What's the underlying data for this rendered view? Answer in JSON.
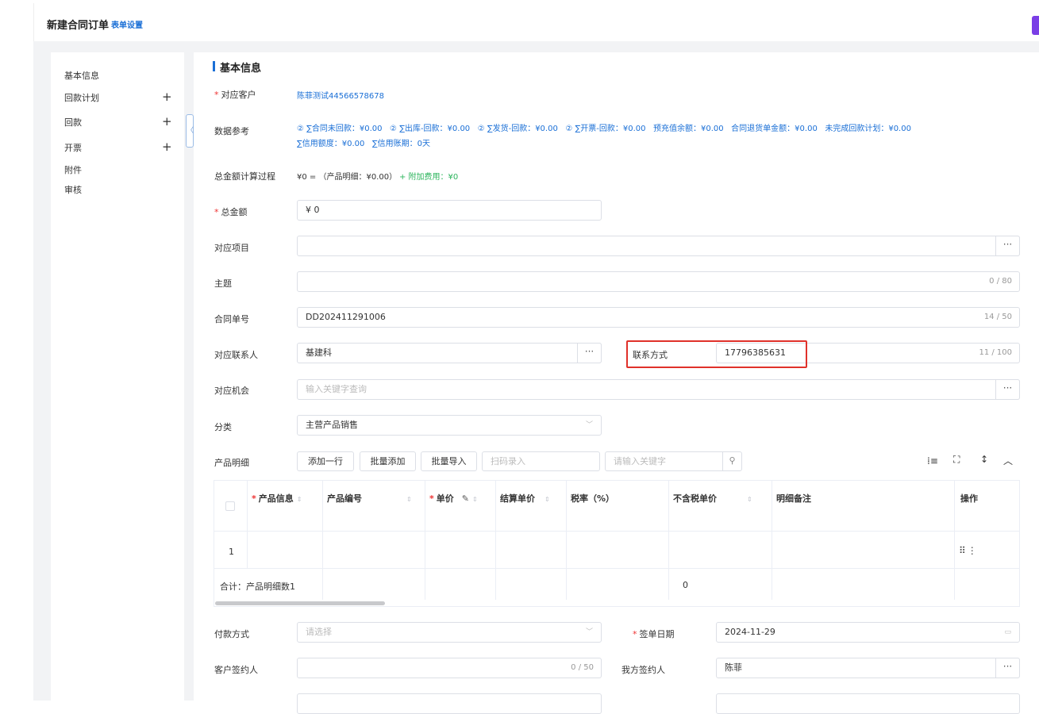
{
  "header": {
    "title": "新建合同订单",
    "setting": "表单设置"
  },
  "sidebar": {
    "items": [
      {
        "label": "基本信息",
        "plus": ""
      },
      {
        "label": "回款计划",
        "plus": "+"
      },
      {
        "label": "回款",
        "plus": "+"
      },
      {
        "label": "开票",
        "plus": "+"
      },
      {
        "label": "附件",
        "plus": ""
      },
      {
        "label": "审核",
        "plus": ""
      }
    ]
  },
  "section": {
    "title": "基本信息"
  },
  "form": {
    "customer": {
      "label": "对应客户",
      "value": "陈菲测试44566578678"
    },
    "dataref": {
      "label": "数据参考",
      "line1": "② ∑合同未回款：¥0.00   ② ∑出库-回款：¥0.00   ② ∑发货-回款：¥0.00   ② ∑开票-回款：¥0.00   预充值余额：¥0.00   合同退货单金额：¥0.00   未完成回款计划：¥0.00",
      "line2": "∑信用额度：¥0.00   ∑信用账期：0天"
    },
    "calc": {
      "label": "总金额计算过程",
      "formula": "¥0 = （产品明细：¥0.00）",
      "extra": "+ 附加费用：¥0"
    },
    "total": {
      "label": "总金额",
      "value": "¥ 0"
    },
    "project": {
      "label": "对应项目"
    },
    "subject": {
      "label": "主题",
      "count": "0 / 80"
    },
    "contractno": {
      "label": "合同单号",
      "value": "DD202411291006",
      "count": "14 / 50"
    },
    "contact": {
      "label": "对应联系人",
      "value": "基建科"
    },
    "phone": {
      "label": "联系方式",
      "value": "17796385631",
      "count": "11 / 100"
    },
    "opportunity": {
      "label": "对应机会",
      "placeholder": "输入关键字查询"
    },
    "category": {
      "label": "分类",
      "value": "主营产品销售"
    },
    "product": {
      "label": "产品明细",
      "add_row": "添加一行",
      "batch_add": "批量添加",
      "batch_import": "批量导入",
      "scan_placeholder": "扫码录入",
      "keyword_placeholder": "请输入关键字"
    },
    "payment": {
      "label": "付款方式",
      "placeholder": "请选择"
    },
    "signdate": {
      "label": "签单日期",
      "value": "2024-11-29"
    },
    "custsigner": {
      "label": "客户签约人",
      "count": "0 / 50"
    },
    "oursigner": {
      "label": "我方签约人",
      "value": "陈菲"
    }
  },
  "table": {
    "headers": [
      "产品信息",
      "产品编号",
      "单价",
      "结算单价",
      "税率（%）",
      "不含税单价",
      "明细备注",
      "操作"
    ],
    "row_index": "1",
    "summary": "合计：产品明细数1",
    "summary_value": "0"
  },
  "icons": [
    "more-icon",
    "calendar-icon",
    "search-icon",
    "chevron-down-icon",
    "fullscreen-icon",
    "column-setting-icon",
    "collapse-icon",
    "drag-icon",
    "edit-icon"
  ]
}
